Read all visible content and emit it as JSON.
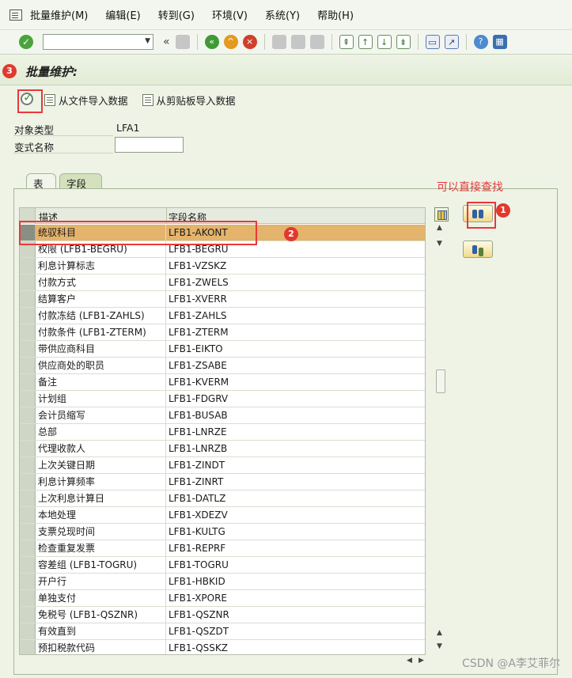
{
  "menu": [
    "批量维护(M)",
    "编辑(E)",
    "转到(G)",
    "环境(V)",
    "系统(Y)",
    "帮助(H)"
  ],
  "toolbar": {
    "ok_icon": "check-circle-icon",
    "command_field": "",
    "double_arrow": "«"
  },
  "title": "批量维护:",
  "app_toolbar": {
    "execute_icon": "execute-icon",
    "import_file_label": "从文件导入数据",
    "import_clipboard_label": "从剪贴板导入数据"
  },
  "form": {
    "object_type_label": "对象类型",
    "object_type_value": "LFA1",
    "variant_label": "变式名称",
    "variant_value": ""
  },
  "tabs": [
    "表",
    "字段"
  ],
  "active_tab": "字段",
  "table": {
    "headers": [
      "描述",
      "字段名称"
    ],
    "rows": [
      [
        "统驭科目",
        "LFB1-AKONT"
      ],
      [
        "权限 (LFB1-BEGRU)",
        "LFB1-BEGRU"
      ],
      [
        "利息计算标志",
        "LFB1-VZSKZ"
      ],
      [
        "付款方式",
        "LFB1-ZWELS"
      ],
      [
        "结算客户",
        "LFB1-XVERR"
      ],
      [
        "付款冻结 (LFB1-ZAHLS)",
        "LFB1-ZAHLS"
      ],
      [
        "付款条件 (LFB1-ZTERM)",
        "LFB1-ZTERM"
      ],
      [
        "带供应商科目",
        "LFB1-EIKTO"
      ],
      [
        "供应商处的职员",
        "LFB1-ZSABE"
      ],
      [
        "备注",
        "LFB1-KVERM"
      ],
      [
        "计划组",
        "LFB1-FDGRV"
      ],
      [
        "会计员缩写",
        "LFB1-BUSAB"
      ],
      [
        "总部",
        "LFB1-LNRZE"
      ],
      [
        "代理收款人",
        "LFB1-LNRZB"
      ],
      [
        "上次关键日期",
        "LFB1-ZINDT"
      ],
      [
        "利息计算频率",
        "LFB1-ZINRT"
      ],
      [
        "上次利息计算日",
        "LFB1-DATLZ"
      ],
      [
        "本地处理",
        "LFB1-XDEZV"
      ],
      [
        "支票兑现时间",
        "LFB1-KULTG"
      ],
      [
        "检查重复发票",
        "LFB1-REPRF"
      ],
      [
        "容差组 (LFB1-TOGRU)",
        "LFB1-TOGRU"
      ],
      [
        "开户行",
        "LFB1-HBKID"
      ],
      [
        "单独支付",
        "LFB1-XPORE"
      ],
      [
        "免税号 (LFB1-QSZNR)",
        "LFB1-QSZNR"
      ],
      [
        "有效直到",
        "LFB1-QSZDT"
      ],
      [
        "预扣税款代码",
        "LFB1-QSSKZ"
      ]
    ],
    "selected_row": 0
  },
  "annotations": {
    "badge1": "1",
    "badge2": "2",
    "badge3": "3",
    "note": "可以直接查找"
  },
  "watermark": "CSDN @A李艾菲尔"
}
